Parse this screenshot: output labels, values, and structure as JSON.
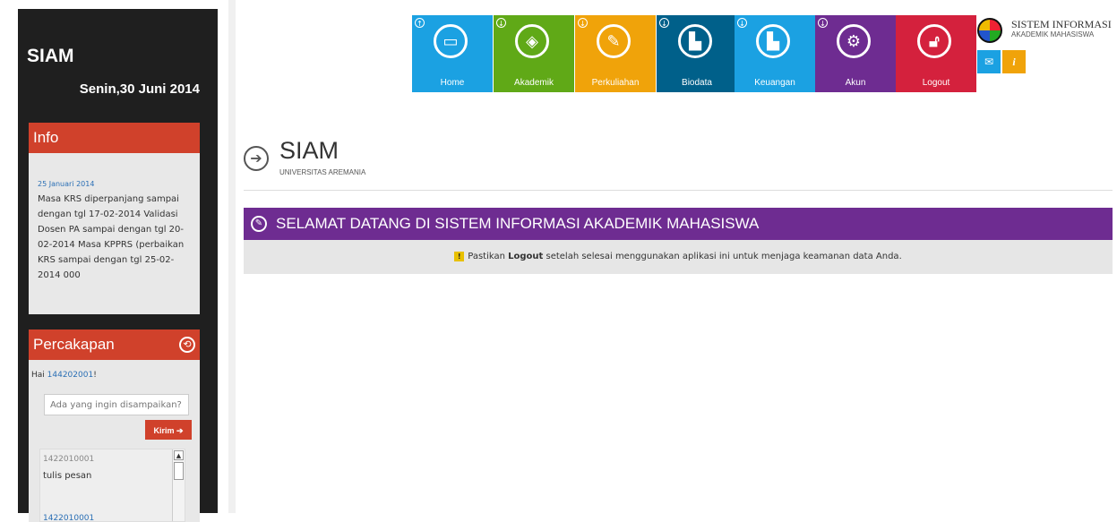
{
  "sidebar": {
    "brand": "SIAM",
    "date": "Senin,30 Juni 2014",
    "info": {
      "title": "Info",
      "date": "25 Januari 2014",
      "text": "Masa KRS diperpanjang sampai dengan tgl 17-02-2014 Validasi Dosen PA sampai dengan tgl 20-02-2014 Masa KPPRS (perbaikan KRS sampai dengan tgl 25-02-2014 000"
    },
    "chat": {
      "title": "Percakapan",
      "greeting_prefix": "Hai ",
      "user_id": "144202001",
      "greeting_suffix": "!",
      "input_placeholder": "Ada yang ingin disampaikan?",
      "send_label": "Kirim",
      "messages": [
        {
          "user": "1422010001",
          "text": "tulis pesan"
        },
        {
          "user": "1422010001",
          "text": ""
        }
      ]
    }
  },
  "tiles": [
    {
      "label": "Home",
      "color": "#1ba1e2",
      "arrow": "up",
      "icon": "monitor-icon"
    },
    {
      "label": "Akademik",
      "color": "#60a917",
      "arrow": "down",
      "icon": "box-icon"
    },
    {
      "label": "Perkuliahan",
      "color": "#f0a30a",
      "arrow": "down",
      "icon": "pencil-icon"
    },
    {
      "label": "Biodata",
      "color": "#00608a",
      "arrow": "down",
      "icon": "chart-icon"
    },
    {
      "label": "Keuangan",
      "color": "#1ba1e2",
      "arrow": "down",
      "icon": "chart-icon"
    },
    {
      "label": "Akun",
      "color": "#6e2c91",
      "arrow": "down",
      "icon": "gear-icon"
    },
    {
      "label": "Logout",
      "color": "#d4213d",
      "arrow": "",
      "icon": "unlock-icon"
    }
  ],
  "system": {
    "title": "SISTEM INFORMASI",
    "subtitle": "AKADEMIK MAHASISWA"
  },
  "main": {
    "title": "SIAM",
    "subtitle": "UNIVERSITAS AREMANIA",
    "welcome": "SELAMAT DATANG DI SISTEM INFORMASI AKADEMIK MAHASISWA",
    "notice_before": "Pastikan ",
    "notice_bold": "Logout",
    "notice_after": " setelah selesai menggunakan aplikasi ini untuk menjaga keamanan data Anda."
  }
}
